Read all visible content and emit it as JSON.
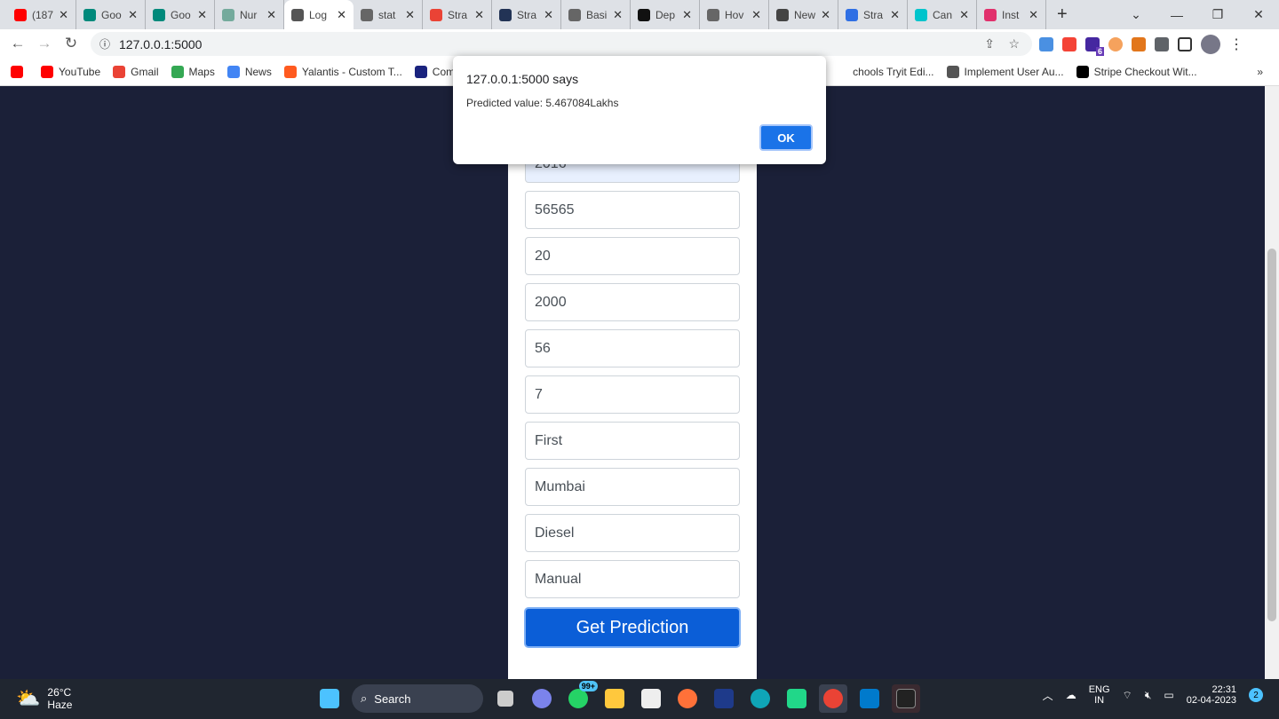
{
  "browser": {
    "tabs": [
      {
        "label": "(187",
        "color": "#ff0000"
      },
      {
        "label": "Goo",
        "color": "#00897b"
      },
      {
        "label": "Goo",
        "color": "#00897b"
      },
      {
        "label": "Nur",
        "color": "#74aa9c"
      },
      {
        "label": "Log",
        "color": "#555555",
        "active": true
      },
      {
        "label": "stat",
        "color": "#666666"
      },
      {
        "label": "Stra",
        "color": "#ea4335"
      },
      {
        "label": "Stra",
        "color": "#223355"
      },
      {
        "label": "Basi",
        "color": "#666666"
      },
      {
        "label": "Dep",
        "color": "#111111"
      },
      {
        "label": "Hov",
        "color": "#666666"
      },
      {
        "label": "New",
        "color": "#444444"
      },
      {
        "label": "Stra",
        "color": "#2f6fe4"
      },
      {
        "label": "Can",
        "color": "#00c4cc"
      },
      {
        "label": "Inst",
        "color": "#e1306c"
      }
    ],
    "url": "127.0.0.1:5000",
    "bookmarks": [
      {
        "label": "",
        "color": "#ff0000"
      },
      {
        "label": "YouTube",
        "color": "#ff0000"
      },
      {
        "label": "Gmail",
        "color": "#ea4335"
      },
      {
        "label": "Maps",
        "color": "#34a853"
      },
      {
        "label": "News",
        "color": "#4285f4"
      },
      {
        "label": "Yalantis - Custom T...",
        "color": "#ff5a1f"
      },
      {
        "label": "Com",
        "color": "#1a237e"
      }
    ],
    "bookmarks_right": [
      {
        "label": "chools Tryit Edi...",
        "color": ""
      },
      {
        "label": "Implement User Au...",
        "color": "#555555"
      },
      {
        "label": "Stripe Checkout Wit...",
        "color": "#000000"
      }
    ],
    "more": "»",
    "ext_badge": "6"
  },
  "form": {
    "fields": [
      "2016",
      "56565",
      "20",
      "2000",
      "56",
      "7",
      "First",
      "Mumbai",
      "Diesel",
      "Manual"
    ],
    "submit": "Get Prediction"
  },
  "dialog": {
    "title": "127.0.0.1:5000 says",
    "message": "Predicted value: 5.467084Lakhs",
    "ok": "OK"
  },
  "taskbar": {
    "temp": "26°C",
    "weather": "Haze",
    "search": "Search",
    "whatsapp_badge": "99+",
    "lang1": "ENG",
    "lang2": "IN",
    "time": "22:31",
    "date": "02-04-2023",
    "notif": "2"
  }
}
